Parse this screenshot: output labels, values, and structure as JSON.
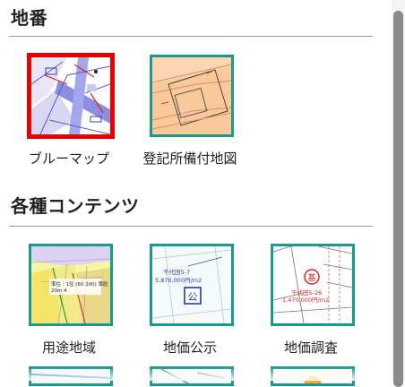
{
  "sections": [
    {
      "title": "地番",
      "items": [
        {
          "label": "ブルーマップ",
          "icon": "blue-map-thumbnail-icon",
          "selected": true
        },
        {
          "label": "登記所備付地図",
          "icon": "registry-map-thumbnail-icon",
          "selected": false
        }
      ]
    },
    {
      "title": "各種コンテンツ",
      "items": [
        {
          "label": "用途地域",
          "icon": "zoning-map-thumbnail-icon",
          "map_text": [
            "準住｜1住 (60 200) 準防",
            "20m 4"
          ]
        },
        {
          "label": "地価公示",
          "icon": "land-price-publication-thumbnail-icon",
          "map_text": [
            "千代田5-7",
            "5,870,000円/m2",
            "公"
          ]
        },
        {
          "label": "地価調査",
          "icon": "land-price-survey-thumbnail-icon",
          "map_text": [
            "基",
            "千代田5-26",
            "1,470,000円/m2"
          ]
        }
      ]
    }
  ],
  "colors": {
    "tile_border": "#1a9a8e",
    "selected_border": "#e60000",
    "divider": "#9a9a9a",
    "scroll_thumb": "#8a8a8a"
  }
}
